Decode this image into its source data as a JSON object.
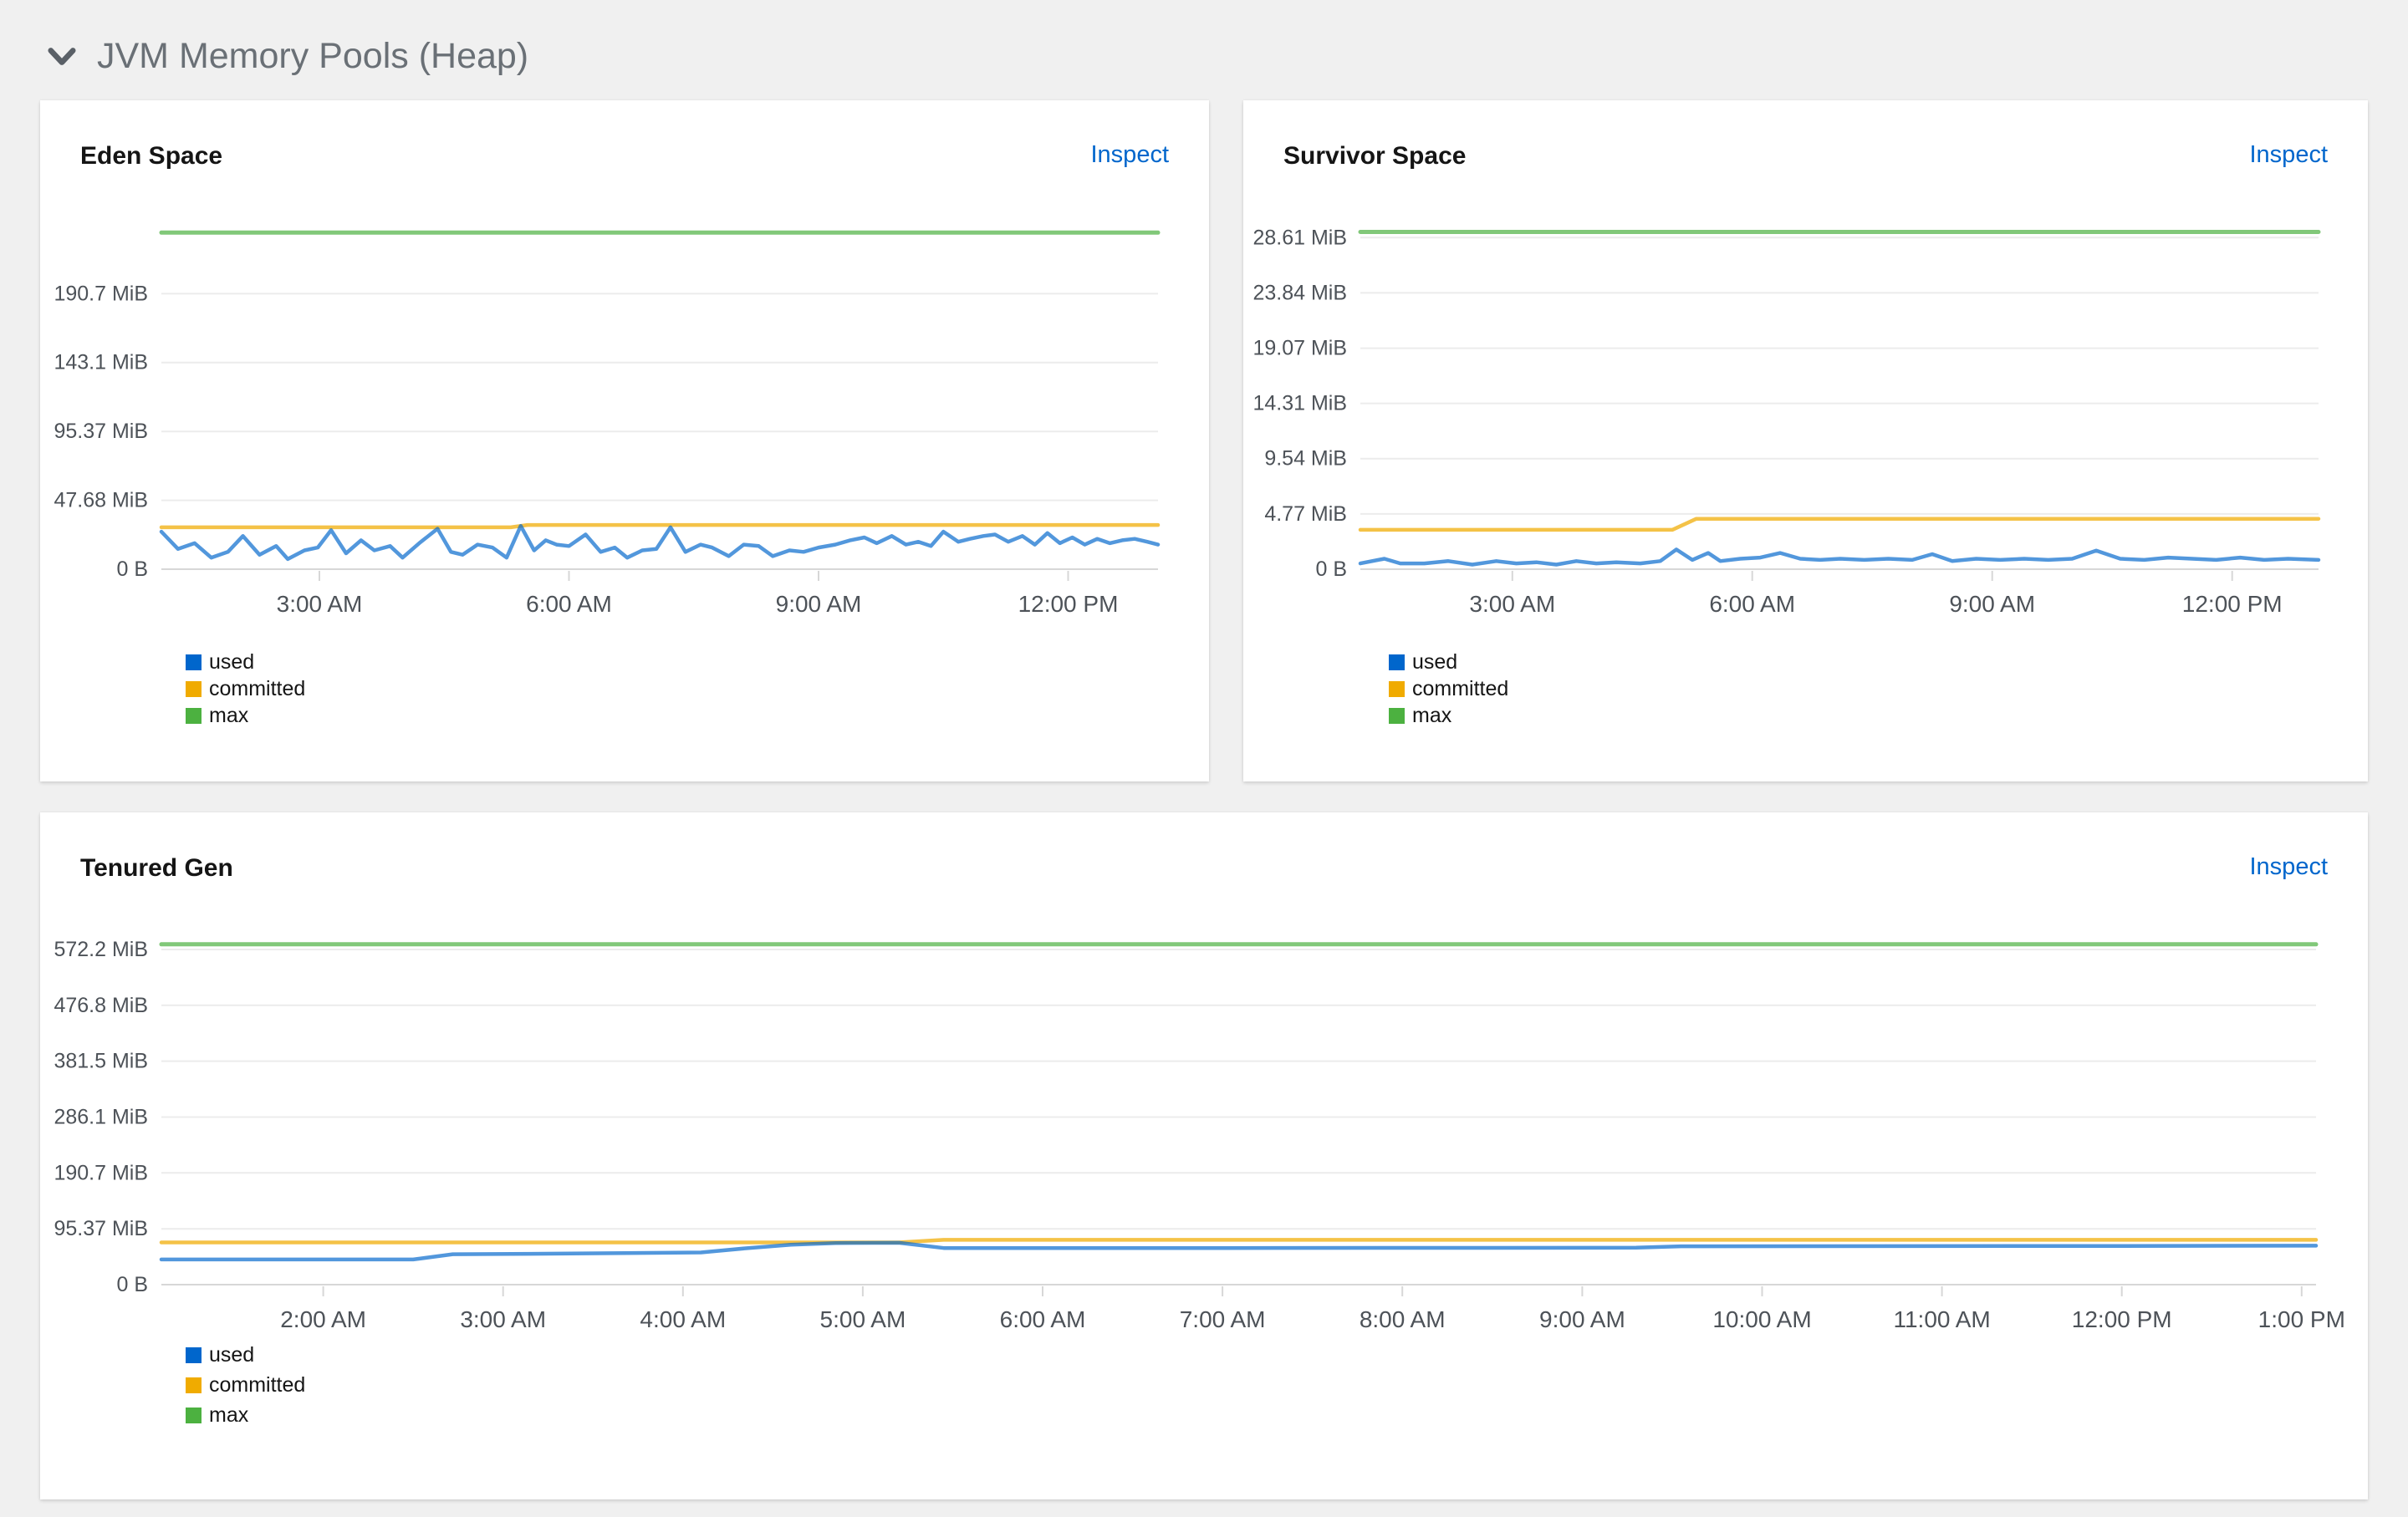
{
  "section": {
    "title": "JVM Memory Pools (Heap)",
    "chevron_icon": "angle-down-icon"
  },
  "colors": {
    "used": "#0066cc",
    "committed": "#f0ab00",
    "max": "#4cb140",
    "link": "#0066cc",
    "axis_label": "#4d5258",
    "grid_line": "#ececec",
    "axis_line": "#d7d7d7",
    "page_background": "#f0f0f0",
    "card_background": "#ffffff"
  },
  "chart_data": [
    {
      "type": "line",
      "title": "Eden Space",
      "inspect_label": "Inspect",
      "unit": "MiB",
      "x_range_hours": [
        1.1,
        13.08
      ],
      "y_max": 235.5,
      "grid": true,
      "legend_position": "bottom-left",
      "y_ticks": [
        {
          "label": "0 B",
          "value": 0
        },
        {
          "label": "47.68 MiB",
          "value": 47.68
        },
        {
          "label": "95.37 MiB",
          "value": 95.37
        },
        {
          "label": "143.1 MiB",
          "value": 143.1
        },
        {
          "label": "190.7 MiB",
          "value": 190.7
        }
      ],
      "x_ticks": [
        {
          "label": "3:00 AM",
          "hour": 3
        },
        {
          "label": "6:00 AM",
          "hour": 6
        },
        {
          "label": "9:00 AM",
          "hour": 9
        },
        {
          "label": "12:00 PM",
          "hour": 12
        }
      ],
      "series": [
        {
          "name": "used",
          "color": "#0066cc",
          "points": [
            [
              1.1,
              26
            ],
            [
              1.3,
              14
            ],
            [
              1.5,
              18
            ],
            [
              1.7,
              8
            ],
            [
              1.9,
              12
            ],
            [
              2.08,
              23
            ],
            [
              2.28,
              10
            ],
            [
              2.48,
              16
            ],
            [
              2.62,
              7
            ],
            [
              2.82,
              13
            ],
            [
              2.98,
              15
            ],
            [
              3.14,
              27
            ],
            [
              3.32,
              11
            ],
            [
              3.5,
              20
            ],
            [
              3.66,
              13
            ],
            [
              3.85,
              16
            ],
            [
              4.0,
              8
            ],
            [
              4.2,
              18
            ],
            [
              4.42,
              28
            ],
            [
              4.58,
              12
            ],
            [
              4.72,
              10
            ],
            [
              4.9,
              17
            ],
            [
              5.08,
              15
            ],
            [
              5.25,
              8
            ],
            [
              5.42,
              30
            ],
            [
              5.58,
              13
            ],
            [
              5.72,
              20
            ],
            [
              5.85,
              17
            ],
            [
              6.0,
              16
            ],
            [
              6.2,
              24
            ],
            [
              6.38,
              12
            ],
            [
              6.55,
              15
            ],
            [
              6.7,
              8
            ],
            [
              6.88,
              13
            ],
            [
              7.05,
              14
            ],
            [
              7.22,
              29
            ],
            [
              7.4,
              12
            ],
            [
              7.58,
              17
            ],
            [
              7.72,
              15
            ],
            [
              7.92,
              9
            ],
            [
              8.1,
              17
            ],
            [
              8.28,
              16
            ],
            [
              8.45,
              9
            ],
            [
              8.65,
              13
            ],
            [
              8.82,
              12
            ],
            [
              9.0,
              15
            ],
            [
              9.2,
              17
            ],
            [
              9.38,
              20
            ],
            [
              9.55,
              22
            ],
            [
              9.7,
              18
            ],
            [
              9.88,
              23
            ],
            [
              10.05,
              17
            ],
            [
              10.2,
              19
            ],
            [
              10.35,
              16
            ],
            [
              10.5,
              26
            ],
            [
              10.68,
              19
            ],
            [
              10.82,
              21
            ],
            [
              10.98,
              23
            ],
            [
              11.12,
              24
            ],
            [
              11.28,
              19
            ],
            [
              11.45,
              23
            ],
            [
              11.6,
              17
            ],
            [
              11.75,
              25
            ],
            [
              11.9,
              18
            ],
            [
              12.05,
              22
            ],
            [
              12.2,
              17
            ],
            [
              12.35,
              21
            ],
            [
              12.5,
              18
            ],
            [
              12.65,
              20
            ],
            [
              12.8,
              21
            ],
            [
              12.95,
              19
            ],
            [
              13.08,
              17
            ]
          ]
        },
        {
          "name": "committed",
          "color": "#f0ab00",
          "points": [
            [
              1.1,
              29
            ],
            [
              5.3,
              29
            ],
            [
              5.5,
              30.6
            ],
            [
              13.08,
              30.6
            ]
          ]
        },
        {
          "name": "max",
          "color": "#4cb140",
          "points": [
            [
              1.1,
              233
            ],
            [
              13.08,
              233
            ]
          ]
        }
      ]
    },
    {
      "type": "line",
      "title": "Survivor Space",
      "inspect_label": "Inspect",
      "unit": "MiB",
      "x_range_hours": [
        1.1,
        13.08
      ],
      "y_max": 29.35,
      "grid": true,
      "legend_position": "bottom-left",
      "y_ticks": [
        {
          "label": "0 B",
          "value": 0
        },
        {
          "label": "4.77 MiB",
          "value": 4.77
        },
        {
          "label": "9.54 MiB",
          "value": 9.54
        },
        {
          "label": "14.31 MiB",
          "value": 14.31
        },
        {
          "label": "19.07 MiB",
          "value": 19.07
        },
        {
          "label": "23.84 MiB",
          "value": 23.84
        },
        {
          "label": "28.61 MiB",
          "value": 28.61
        }
      ],
      "x_ticks": [
        {
          "label": "3:00 AM",
          "hour": 3
        },
        {
          "label": "6:00 AM",
          "hour": 6
        },
        {
          "label": "9:00 AM",
          "hour": 9
        },
        {
          "label": "12:00 PM",
          "hour": 12
        }
      ],
      "series": [
        {
          "name": "used",
          "color": "#0066cc",
          "points": [
            [
              1.1,
              0.5
            ],
            [
              1.4,
              0.9
            ],
            [
              1.6,
              0.5
            ],
            [
              1.9,
              0.5
            ],
            [
              2.2,
              0.7
            ],
            [
              2.5,
              0.4
            ],
            [
              2.8,
              0.7
            ],
            [
              3.05,
              0.5
            ],
            [
              3.3,
              0.6
            ],
            [
              3.55,
              0.4
            ],
            [
              3.8,
              0.7
            ],
            [
              4.05,
              0.5
            ],
            [
              4.3,
              0.6
            ],
            [
              4.6,
              0.5
            ],
            [
              4.85,
              0.7
            ],
            [
              5.05,
              1.7
            ],
            [
              5.25,
              0.8
            ],
            [
              5.45,
              1.4
            ],
            [
              5.6,
              0.7
            ],
            [
              5.85,
              0.9
            ],
            [
              6.1,
              1.0
            ],
            [
              6.35,
              1.4
            ],
            [
              6.6,
              0.9
            ],
            [
              6.85,
              0.8
            ],
            [
              7.1,
              0.9
            ],
            [
              7.4,
              0.8
            ],
            [
              7.7,
              0.9
            ],
            [
              8.0,
              0.8
            ],
            [
              8.25,
              1.3
            ],
            [
              8.5,
              0.7
            ],
            [
              8.8,
              0.9
            ],
            [
              9.1,
              0.8
            ],
            [
              9.4,
              0.9
            ],
            [
              9.7,
              0.8
            ],
            [
              10.0,
              0.9
            ],
            [
              10.3,
              1.6
            ],
            [
              10.6,
              0.9
            ],
            [
              10.9,
              0.8
            ],
            [
              11.2,
              1.0
            ],
            [
              11.5,
              0.9
            ],
            [
              11.8,
              0.8
            ],
            [
              12.1,
              1.0
            ],
            [
              12.4,
              0.8
            ],
            [
              12.7,
              0.9
            ],
            [
              13.08,
              0.8
            ]
          ]
        },
        {
          "name": "committed",
          "color": "#f0ab00",
          "points": [
            [
              1.1,
              3.4
            ],
            [
              5.0,
              3.4
            ],
            [
              5.3,
              4.35
            ],
            [
              13.08,
              4.35
            ]
          ]
        },
        {
          "name": "max",
          "color": "#4cb140",
          "points": [
            [
              1.1,
              29.1
            ],
            [
              13.08,
              29.1
            ]
          ]
        }
      ]
    },
    {
      "type": "line",
      "title": "Tenured Gen",
      "inspect_label": "Inspect",
      "unit": "MiB",
      "x_range_hours": [
        1.1,
        13.08
      ],
      "y_max": 585,
      "grid": true,
      "legend_position": "bottom-left",
      "y_ticks": [
        {
          "label": "0 B",
          "value": 0
        },
        {
          "label": "95.37 MiB",
          "value": 95.37
        },
        {
          "label": "190.7 MiB",
          "value": 190.7
        },
        {
          "label": "286.1 MiB",
          "value": 286.1
        },
        {
          "label": "381.5 MiB",
          "value": 381.5
        },
        {
          "label": "476.8 MiB",
          "value": 476.8
        },
        {
          "label": "572.2 MiB",
          "value": 572.2
        }
      ],
      "x_ticks": [
        {
          "label": "2:00 AM",
          "hour": 2
        },
        {
          "label": "3:00 AM",
          "hour": 3
        },
        {
          "label": "4:00 AM",
          "hour": 4
        },
        {
          "label": "5:00 AM",
          "hour": 5
        },
        {
          "label": "6:00 AM",
          "hour": 6
        },
        {
          "label": "7:00 AM",
          "hour": 7
        },
        {
          "label": "8:00 AM",
          "hour": 8
        },
        {
          "label": "9:00 AM",
          "hour": 9
        },
        {
          "label": "10:00 AM",
          "hour": 10
        },
        {
          "label": "11:00 AM",
          "hour": 11
        },
        {
          "label": "12:00 PM",
          "hour": 12
        },
        {
          "label": "1:00 PM",
          "hour": 13
        }
      ],
      "series": [
        {
          "name": "used",
          "color": "#0066cc",
          "points": [
            [
              1.1,
              43
            ],
            [
              2.5,
              43
            ],
            [
              2.72,
              52
            ],
            [
              3.3,
              53
            ],
            [
              4.1,
              55
            ],
            [
              4.35,
              62
            ],
            [
              4.6,
              68
            ],
            [
              4.85,
              71
            ],
            [
              5.2,
              71.5
            ],
            [
              5.45,
              62.5
            ],
            [
              7.0,
              62.5
            ],
            [
              9.3,
              63
            ],
            [
              9.55,
              65.5
            ],
            [
              12.0,
              66
            ],
            [
              13.08,
              66.5
            ]
          ]
        },
        {
          "name": "committed",
          "color": "#f0ab00",
          "points": [
            [
              1.1,
              72
            ],
            [
              5.2,
              72
            ],
            [
              5.45,
              76.5
            ],
            [
              13.08,
              76.5
            ]
          ]
        },
        {
          "name": "max",
          "color": "#4cb140",
          "points": [
            [
              1.1,
              581
            ],
            [
              13.08,
              581
            ]
          ]
        }
      ]
    }
  ]
}
